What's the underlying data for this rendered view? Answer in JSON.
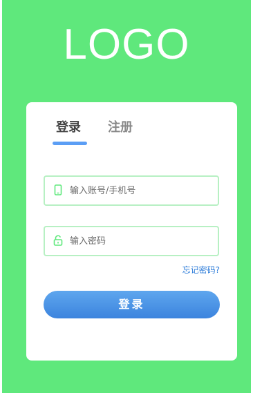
{
  "logo": {
    "text": "LOGO"
  },
  "tabs": [
    {
      "label": "登录",
      "active": true
    },
    {
      "label": "注册",
      "active": false
    }
  ],
  "form": {
    "account_placeholder": "输入账号/手机号",
    "password_placeholder": "输入密码",
    "forgot_label": "忘记密码?",
    "submit_label": "登录"
  },
  "colors": {
    "background": "#5fe87c",
    "card": "#ffffff",
    "accent": "#5b9ef5",
    "input_border": "#b7f0c3",
    "icon": "#5fe87c",
    "link": "#2d7cd9"
  },
  "icons": {
    "account": "phone-icon",
    "password": "unlock-icon"
  }
}
